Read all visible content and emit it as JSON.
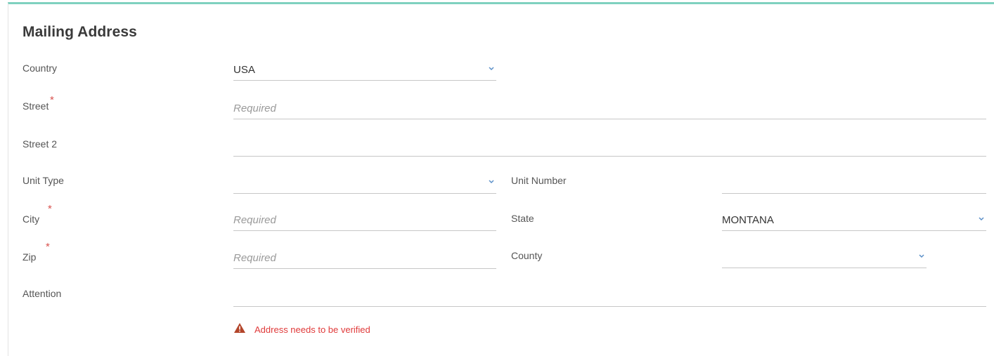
{
  "section": {
    "title": "Mailing Address"
  },
  "fields": {
    "country": {
      "label": "Country",
      "value": "USA"
    },
    "street": {
      "label": "Street",
      "placeholder": "Required",
      "value": ""
    },
    "street2": {
      "label": "Street 2",
      "value": ""
    },
    "unit_type": {
      "label": "Unit Type",
      "value": ""
    },
    "unit_number": {
      "label": "Unit Number",
      "value": ""
    },
    "city": {
      "label": "City",
      "placeholder": "Required",
      "value": ""
    },
    "state": {
      "label": "State",
      "value": "MONTANA"
    },
    "zip": {
      "label": "Zip",
      "placeholder": "Required",
      "value": ""
    },
    "county": {
      "label": "County",
      "value": ""
    },
    "attention": {
      "label": "Attention",
      "value": ""
    }
  },
  "required_marker": "*",
  "warning": {
    "icon": "warning-triangle-icon",
    "text": "Address needs to be verified"
  },
  "colors": {
    "accent": "#7fd1bf",
    "required": "#d9534f",
    "warning": "#e03a3a",
    "chevron": "#5a8fc8"
  }
}
